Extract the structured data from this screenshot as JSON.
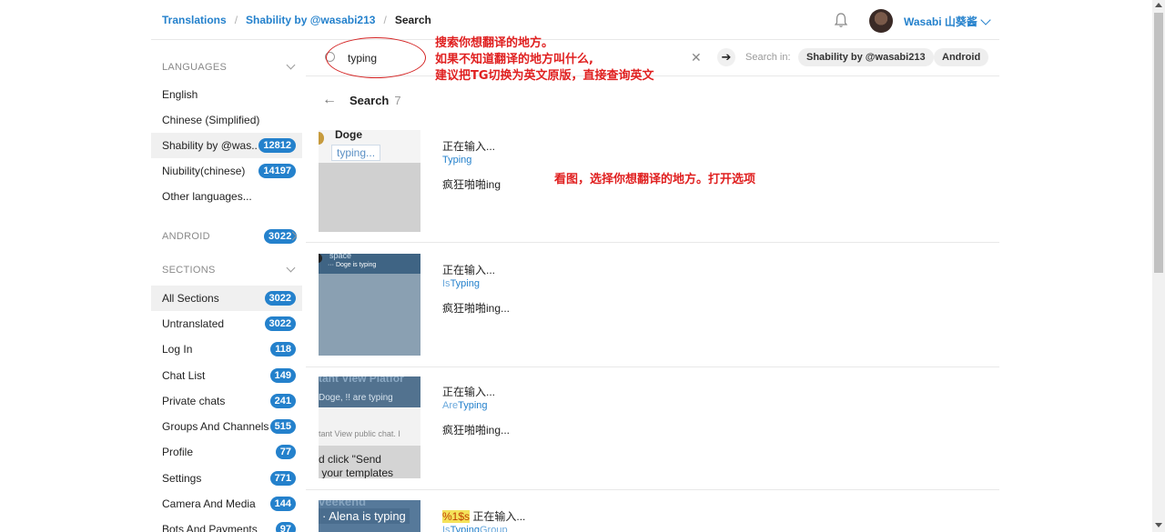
{
  "breadcrumb": {
    "item1": "Translations",
    "item2": "Shability by @wasabi213",
    "current": "Search",
    "sep": "/"
  },
  "user": {
    "name": "Wasabi 山葵酱"
  },
  "sidebar": {
    "languages_header": "LANGUAGES",
    "languages": [
      {
        "label": "English",
        "count": ""
      },
      {
        "label": "Chinese (Simplified)",
        "count": ""
      },
      {
        "label": "Shability by @was...",
        "count": "12812"
      },
      {
        "label": "Niubility(chinese)",
        "count": "14197"
      },
      {
        "label": "Other languages...",
        "count": ""
      }
    ],
    "android_header": "ANDROID",
    "android_count": "3022",
    "sections_header": "SECTIONS",
    "sections": [
      {
        "label": "All Sections",
        "count": "3022"
      },
      {
        "label": "Untranslated",
        "count": "3022"
      },
      {
        "label": "Log In",
        "count": "118"
      },
      {
        "label": "Chat List",
        "count": "149"
      },
      {
        "label": "Private chats",
        "count": "241"
      },
      {
        "label": "Groups And Channels",
        "count": "515"
      },
      {
        "label": "Profile",
        "count": "77"
      },
      {
        "label": "Settings",
        "count": "771"
      },
      {
        "label": "Camera And Media",
        "count": "144"
      },
      {
        "label": "Bots And Payments",
        "count": "97"
      }
    ]
  },
  "search": {
    "value": "typing",
    "search_in_label": "Search in:",
    "scopes": [
      "Shability by @wasabi213",
      "Android"
    ]
  },
  "annotations": {
    "note1": "搜索你想翻译的地方。",
    "note2": "如果不知道翻译的地方叫什么,",
    "note3": "建议把TG切换为英文原版，直接查询英文",
    "note4": "看图，选择你想翻译的地方。打开选项"
  },
  "results_header": {
    "title": "Search",
    "count": "7"
  },
  "results": [
    {
      "translation": "正在输入...",
      "key_pre": "",
      "key_match": "Typing",
      "key_post": "",
      "value": "疯狂啪啪ing",
      "thumb_name": "Doge",
      "thumb_sub": "typing..."
    },
    {
      "translation": "正在输入...",
      "key_pre": "Is",
      "key_match": "Typing",
      "key_post": "",
      "value": "疯狂啪啪ing...",
      "thumb_name": "space",
      "thumb_sub": "··· Doge is typing"
    },
    {
      "translation": "正在输入...",
      "key_pre": "Are",
      "key_match": "Typing",
      "key_post": "",
      "value": "疯狂啪啪ing...",
      "thumb_name": "tant View Platfor",
      "thumb_sub": "Doge, !! are typing",
      "thumb_extra1": "tant View public chat. I",
      "thumb_extra2": "d click \"Send",
      "thumb_extra3": " your templates"
    },
    {
      "translation_prefix": "%1$s",
      "translation": "正在输入...",
      "key_pre": "Is",
      "key_match": "Typing",
      "key_post": "Group",
      "value": "",
      "thumb_name": "veekend",
      "thumb_sub": "· Alena is typing"
    }
  ]
}
